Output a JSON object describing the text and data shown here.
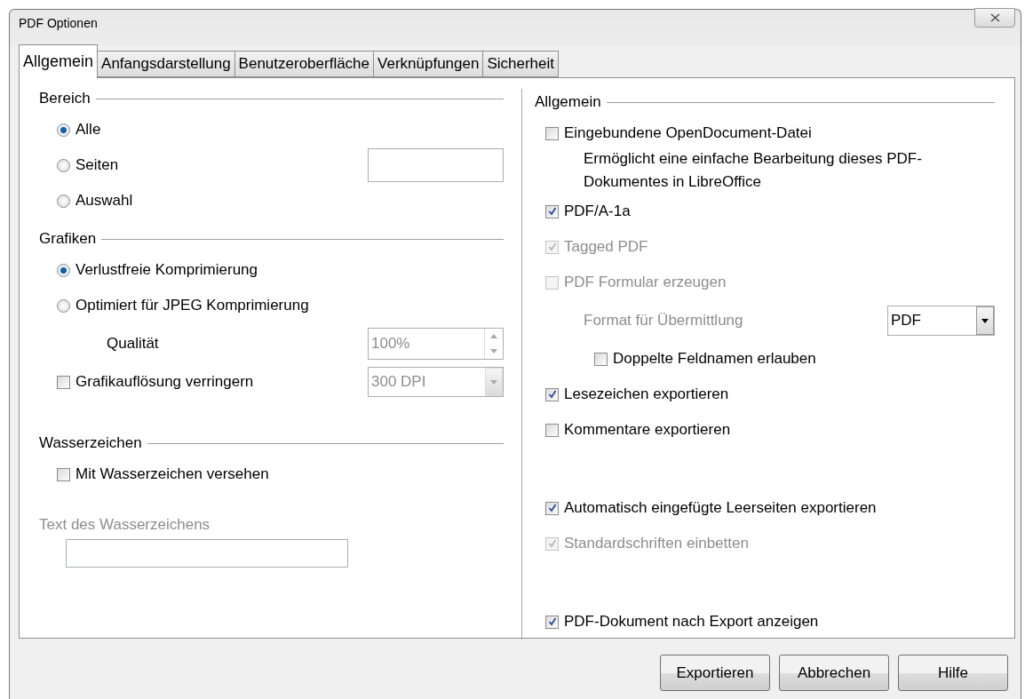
{
  "window": {
    "title": "PDF Optionen"
  },
  "tabs": [
    {
      "label": "Allgemein",
      "selected": true
    },
    {
      "label": "Anfangsdarstellung",
      "selected": false
    },
    {
      "label": "Benutzeroberfläche",
      "selected": false
    },
    {
      "label": "Verknüpfungen",
      "selected": false
    },
    {
      "label": "Sicherheit",
      "selected": false
    }
  ],
  "left_sections": [
    {
      "heading": "Bereich",
      "rows": [
        {
          "kind": "radio",
          "label": "Alle",
          "selected": true
        },
        {
          "kind": "radio",
          "label": "Seiten",
          "selected": false,
          "has_field": true
        },
        {
          "kind": "radio",
          "label": "Auswahl",
          "selected": false
        }
      ]
    },
    {
      "heading": "Grafiken",
      "rows": [
        {
          "kind": "radio",
          "label": "Verlustfreie Komprimierung",
          "selected": true
        },
        {
          "kind": "radio",
          "label": "Optimiert für JPEG Komprimierung",
          "selected": false
        },
        {
          "kind": "spin",
          "label": "Qualität",
          "value": "100%",
          "disabled": true
        },
        {
          "kind": "checkbox",
          "label": "Grafikauflösung verringern",
          "checked": false,
          "select": {
            "value": "300 DPI",
            "disabled": true
          }
        }
      ]
    },
    {
      "heading": "Wasserzeichen",
      "rows": [
        {
          "kind": "checkbox",
          "label": "Mit Wasserzeichen versehen",
          "checked": false
        },
        {
          "kind": "label",
          "label": "Text des Wasserzeichens",
          "disabled": true
        },
        {
          "kind": "textfield"
        }
      ]
    }
  ],
  "right_section": {
    "heading": "Allgemein",
    "rows": [
      {
        "kind": "checkbox",
        "label": "Eingebundene OpenDocument-Datei",
        "checked": false
      },
      {
        "kind": "note",
        "label": "Ermöglicht eine einfache Bearbeitung dieses PDF-Dokumentes in LibreOffice"
      },
      {
        "kind": "checkbox",
        "label": "PDF/A-1a",
        "checked": true
      },
      {
        "kind": "checkbox",
        "label": "Tagged PDF",
        "checked": true,
        "disabled": true
      },
      {
        "kind": "checkbox",
        "label": "PDF Formular erzeugen",
        "checked": false,
        "disabled": true
      },
      {
        "kind": "select",
        "label": "Format für Übermittlung",
        "disabled": true,
        "value": "PDF"
      },
      {
        "kind": "checkbox",
        "label": "Doppelte Feldnamen erlauben",
        "checked": false,
        "indented": true
      },
      {
        "kind": "checkbox",
        "label": "Lesezeichen exportieren",
        "checked": true
      },
      {
        "kind": "checkbox",
        "label": "Kommentare exportieren",
        "checked": false
      },
      {
        "kind": "checkbox",
        "label": "Automatisch eingefügte Leerseiten exportieren",
        "checked": true,
        "gap_before": true
      },
      {
        "kind": "checkbox",
        "label": "Standardschriften einbetten",
        "checked": true,
        "disabled": true
      },
      {
        "kind": "checkbox",
        "label": "PDF-Dokument nach Export anzeigen",
        "checked": true,
        "gap_before": true
      }
    ]
  },
  "buttons": [
    {
      "label": "Exportieren"
    },
    {
      "label": "Abbrechen"
    },
    {
      "label": "Hilfe"
    }
  ]
}
